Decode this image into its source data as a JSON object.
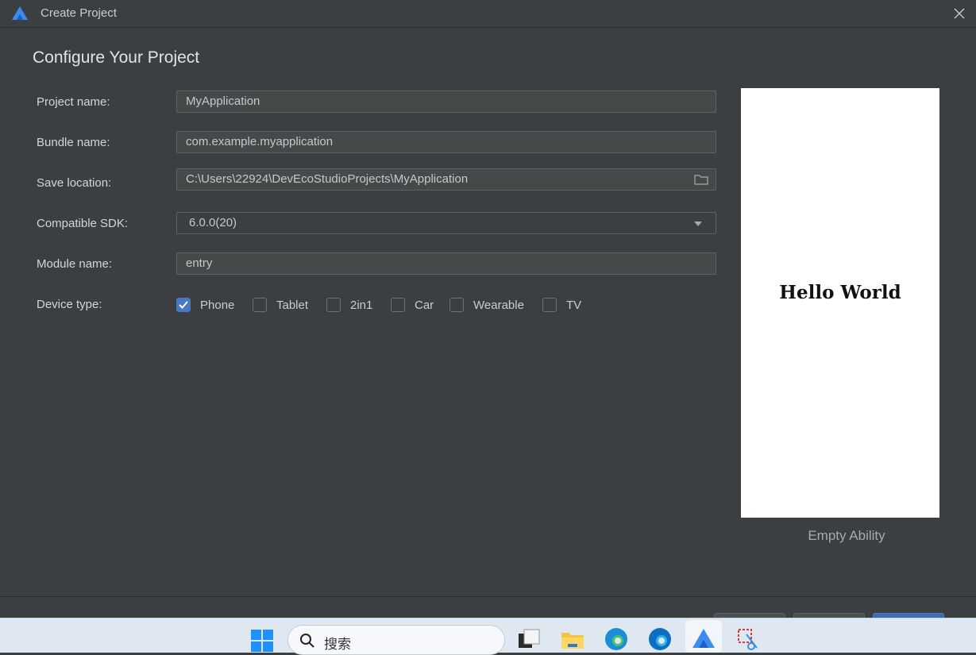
{
  "window": {
    "title": "Create Project"
  },
  "page": {
    "heading": "Configure Your Project"
  },
  "form": {
    "project_name": {
      "label": "Project name:",
      "value": "MyApplication"
    },
    "bundle_name": {
      "label": "Bundle name:",
      "value": "com.example.myapplication"
    },
    "save_location": {
      "label": "Save location:",
      "value": "C:\\Users\\22924\\DevEcoStudioProjects\\MyApplication"
    },
    "compatible_sdk": {
      "label": "Compatible SDK:",
      "value": "6.0.0(20)"
    },
    "module_name": {
      "label": "Module name:",
      "value": "entry"
    },
    "device_type": {
      "label": "Device type:",
      "options": [
        {
          "label": "Phone",
          "checked": true
        },
        {
          "label": "Tablet",
          "checked": false
        },
        {
          "label": "2in1",
          "checked": false
        },
        {
          "label": "Car",
          "checked": false
        },
        {
          "label": "Wearable",
          "checked": false
        },
        {
          "label": "TV",
          "checked": false
        }
      ]
    }
  },
  "preview": {
    "screen_text": "Hello World",
    "caption": "Empty Ability"
  },
  "taskbar": {
    "search_placeholder": "搜索",
    "icons": [
      "windows-start-icon",
      "search-icon",
      "task-view-icon",
      "file-explorer-icon",
      "edge-icon",
      "edge-dev-icon",
      "deveco-studio-icon",
      "snipping-tool-icon"
    ]
  },
  "colors": {
    "dialog_bg": "#3c3f41",
    "field_bg": "#45494a",
    "checkbox_checked": "#4a78c2",
    "taskbar_bg": "#dfe7f1"
  }
}
